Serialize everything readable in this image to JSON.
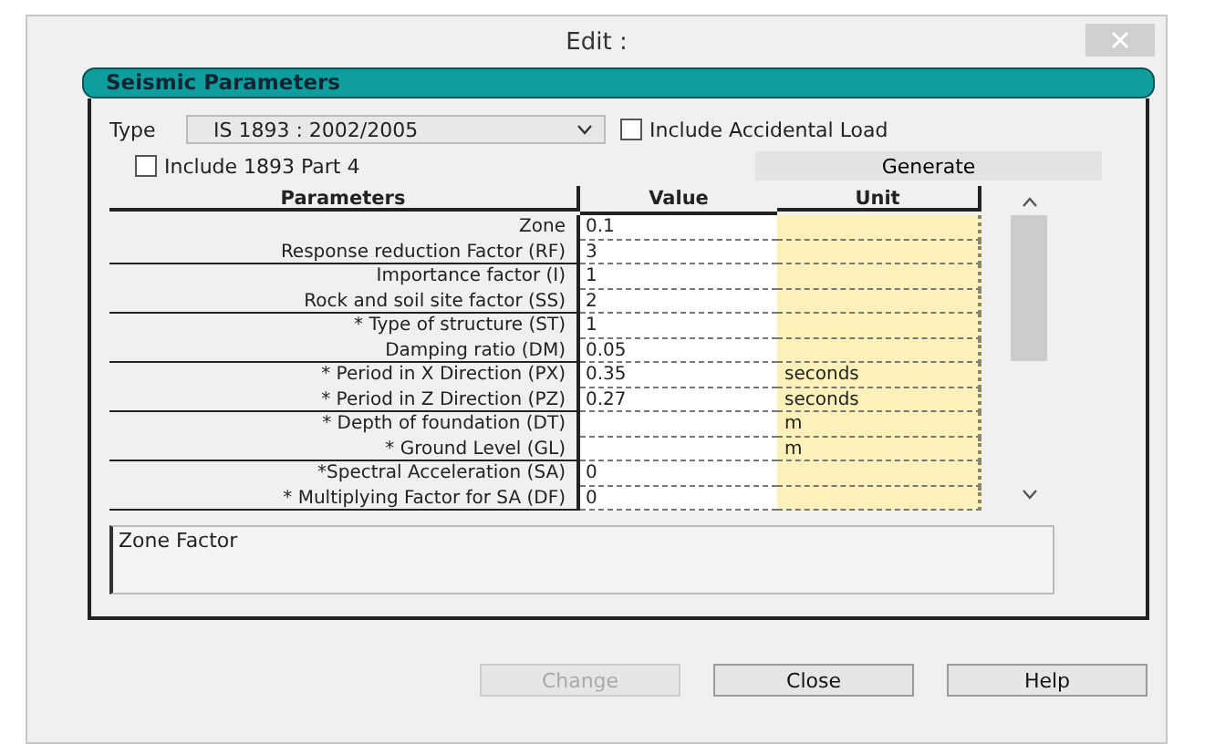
{
  "window": {
    "title": "Edit :"
  },
  "group": {
    "title": "Seismic Parameters"
  },
  "type": {
    "label": "Type",
    "value": "IS 1893 : 2002/2005"
  },
  "options": [
    {
      "label": "Include Accidental Load",
      "checked": false
    },
    {
      "label": "Include 1893 Part 4",
      "checked": false
    }
  ],
  "generate_button": "Generate",
  "table": {
    "columns": [
      "Parameters",
      "Value",
      "Unit"
    ],
    "rows": [
      {
        "parameter": "Zone",
        "value": "0.1",
        "unit": ""
      },
      {
        "parameter": "Response reduction Factor (RF)",
        "value": "3",
        "unit": ""
      },
      {
        "parameter": "Importance factor (I)",
        "value": "1",
        "unit": ""
      },
      {
        "parameter": "Rock and soil site factor (SS)",
        "value": "2",
        "unit": ""
      },
      {
        "parameter": "* Type of structure (ST)",
        "value": "1",
        "unit": ""
      },
      {
        "parameter": "Damping ratio (DM)",
        "value": "0.05",
        "unit": ""
      },
      {
        "parameter": "* Period in X Direction (PX)",
        "value": "0.35",
        "unit": "seconds"
      },
      {
        "parameter": "* Period in Z Direction (PZ)",
        "value": "0.27",
        "unit": "seconds"
      },
      {
        "parameter": "* Depth of foundation (DT)",
        "value": "",
        "unit": "m"
      },
      {
        "parameter": "* Ground Level (GL)",
        "value": "",
        "unit": "m"
      },
      {
        "parameter": "*Spectral Acceleration (SA)",
        "value": "0",
        "unit": ""
      },
      {
        "parameter": "* Multiplying Factor for SA (DF)",
        "value": "0",
        "unit": ""
      }
    ]
  },
  "description": "Zone Factor",
  "buttons": [
    {
      "label": "Change",
      "disabled": true
    },
    {
      "label": "Close",
      "disabled": false
    },
    {
      "label": "Help",
      "disabled": false
    }
  ]
}
